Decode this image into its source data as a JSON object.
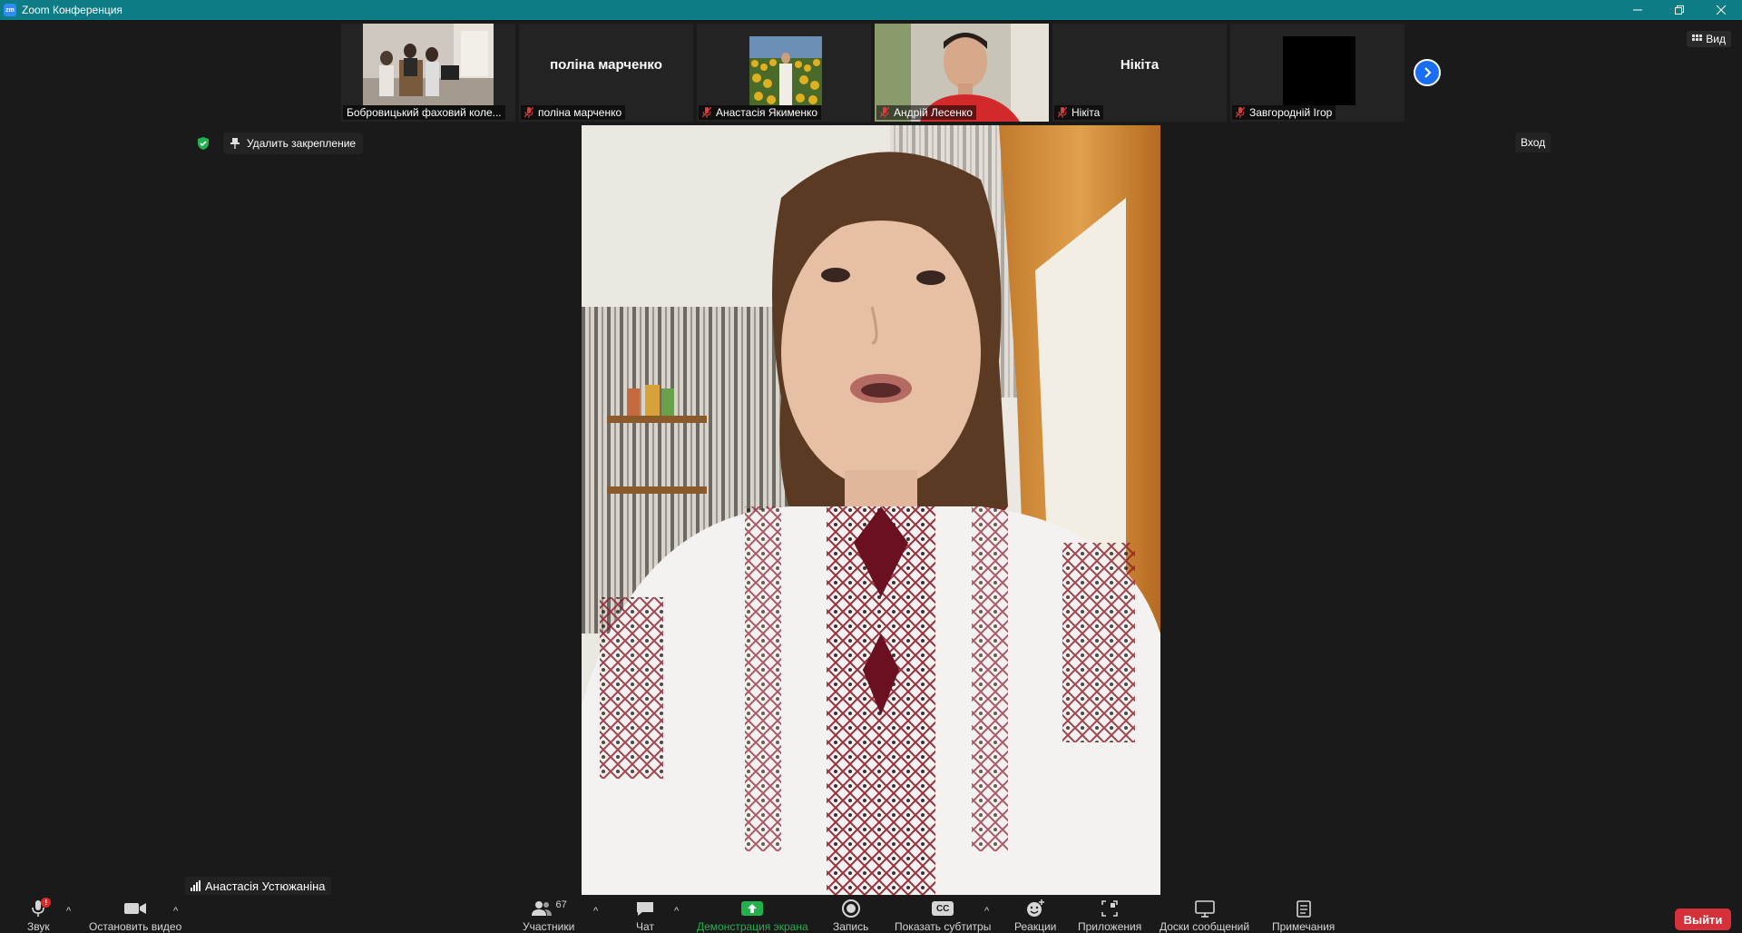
{
  "window": {
    "title": "Zoom Конференция",
    "logo_text": "zm",
    "minimize_icon": "minimize-icon",
    "restore_icon": "restore-icon",
    "close_icon": "close-icon"
  },
  "strip": {
    "tiles": [
      {
        "label": "Бобровицький фаховий коле...",
        "muted": false,
        "type": "video"
      },
      {
        "label": "поліна марченко",
        "name_text": "поліна марченко",
        "muted": true,
        "type": "name"
      },
      {
        "label": "Анастасія Якименко",
        "muted": true,
        "type": "video"
      },
      {
        "label": "Андрій Лесенко",
        "muted": true,
        "type": "video"
      },
      {
        "label": "Нікіта",
        "name_text": "Нікіта",
        "muted": true,
        "type": "name"
      },
      {
        "label": "Завгородній Ігор",
        "muted": true,
        "type": "video"
      }
    ],
    "next_icon": "chevron-right-icon"
  },
  "header": {
    "view_label": "Вид",
    "unpin_label": "Удалить закрепление",
    "enter_label": "Вход"
  },
  "speaker": {
    "name": "Анастасія Устюжаніна"
  },
  "toolbar": {
    "audio_label": "Звук",
    "audio_badge": "!",
    "video_label": "Остановить видео",
    "participants_label": "Участники",
    "participants_count": "67",
    "chat_label": "Чат",
    "share_label": "Демонстрация экрана",
    "record_label": "Запись",
    "cc_label": "Показать субтитры",
    "cc_icon_text": "CC",
    "reactions_label": "Реакции",
    "apps_label": "Приложения",
    "whiteboard_label": "Доски сообщений",
    "notes_label": "Примечания",
    "leave_label": "Выйти"
  },
  "colors": {
    "titlebar": "#0e7c86",
    "background": "#1a1a1a",
    "tile": "#232323",
    "accent_blue": "#1b6ef3",
    "share_green": "#22b14c",
    "leave_red": "#d6303a",
    "mute_red": "#e23b3b",
    "shield_green": "#22b14c"
  }
}
